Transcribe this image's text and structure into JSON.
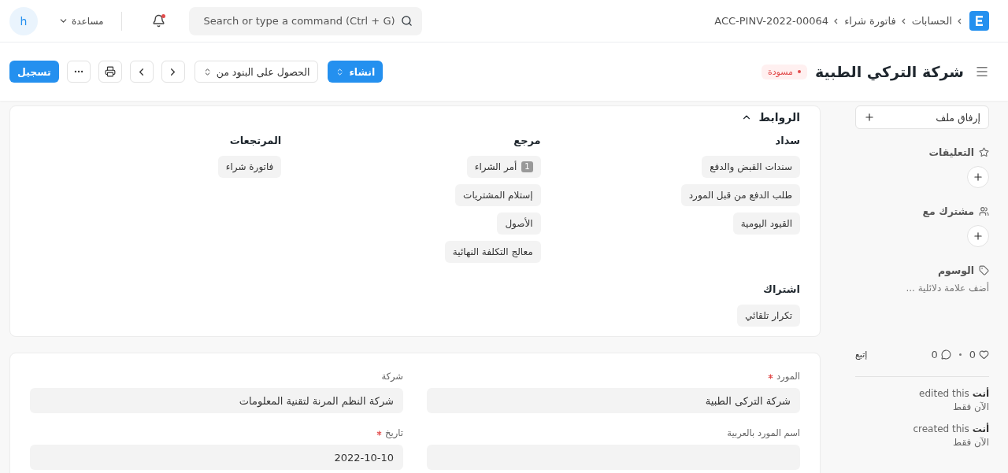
{
  "navbar": {
    "breadcrumbs": [
      "الحسابات",
      "فاتورة شراء",
      "ACC-PINV-2022-00064"
    ],
    "search": {
      "placeholder": "Search or type a command (Ctrl + G)"
    },
    "notifications": {
      "unread": true
    },
    "help": {
      "label": "مساعدة"
    },
    "avatar": {
      "initial": "h"
    }
  },
  "header": {
    "title": "شركة التركي الطبية",
    "status": {
      "label": "مسودة",
      "color": "#e24c4c"
    },
    "create_button": {
      "label": "انشاء"
    },
    "get_items_select": {
      "label": "الحصول على البنود من"
    },
    "submit_button": {
      "label": "تسجيل"
    }
  },
  "sidebar": {
    "attach": {
      "label": "إرفاق ملف"
    },
    "sections": [
      {
        "kind": "assign",
        "title": "التعليقات"
      },
      {
        "kind": "share",
        "title": "مشترك مع"
      },
      {
        "kind": "tags",
        "title": "الوسوم",
        "placeholder": "أضف علامة دلائلية ..."
      }
    ],
    "likes": "0",
    "comments": "0",
    "follow": "إتبع",
    "activity": [
      {
        "text": "**أنت** edited this",
        "time": "الآن فقط"
      },
      {
        "text": "**أنت** created this",
        "time": "الآن فقط"
      }
    ]
  },
  "links": {
    "title": "الروابط",
    "expanded": true,
    "groups": [
      {
        "title": "سداد",
        "items": [
          {
            "label": "سندات القبض والدفع"
          },
          {
            "label": "طلب الدفع من قبل المورد"
          },
          {
            "label": "القيود اليومية"
          }
        ]
      },
      {
        "title": "مرجع",
        "items": [
          {
            "label": "أمر الشراء",
            "count": "1"
          },
          {
            "label": "إستلام المشتريات"
          },
          {
            "label": "الأصول"
          },
          {
            "label": "معالج التكلفة النهائية"
          }
        ]
      },
      {
        "title": "المرتجعات",
        "items": [
          {
            "label": "فاتورة شراء"
          }
        ]
      },
      {
        "title": "اشتراك",
        "items": [
          {
            "label": "تكرار تلقائي"
          }
        ]
      }
    ]
  },
  "fields": [
    {
      "label": "المورد",
      "required": true,
      "value": "شركة التركى الطبية"
    },
    {
      "label": "شركة",
      "required": false,
      "value": "شركة النظم المرنة لتقنية المعلومات"
    },
    {
      "label": "اسم المورد بالعربية",
      "required": false
    },
    {
      "label": "تاريخ",
      "required": true,
      "value": "2022-10-10"
    }
  ]
}
